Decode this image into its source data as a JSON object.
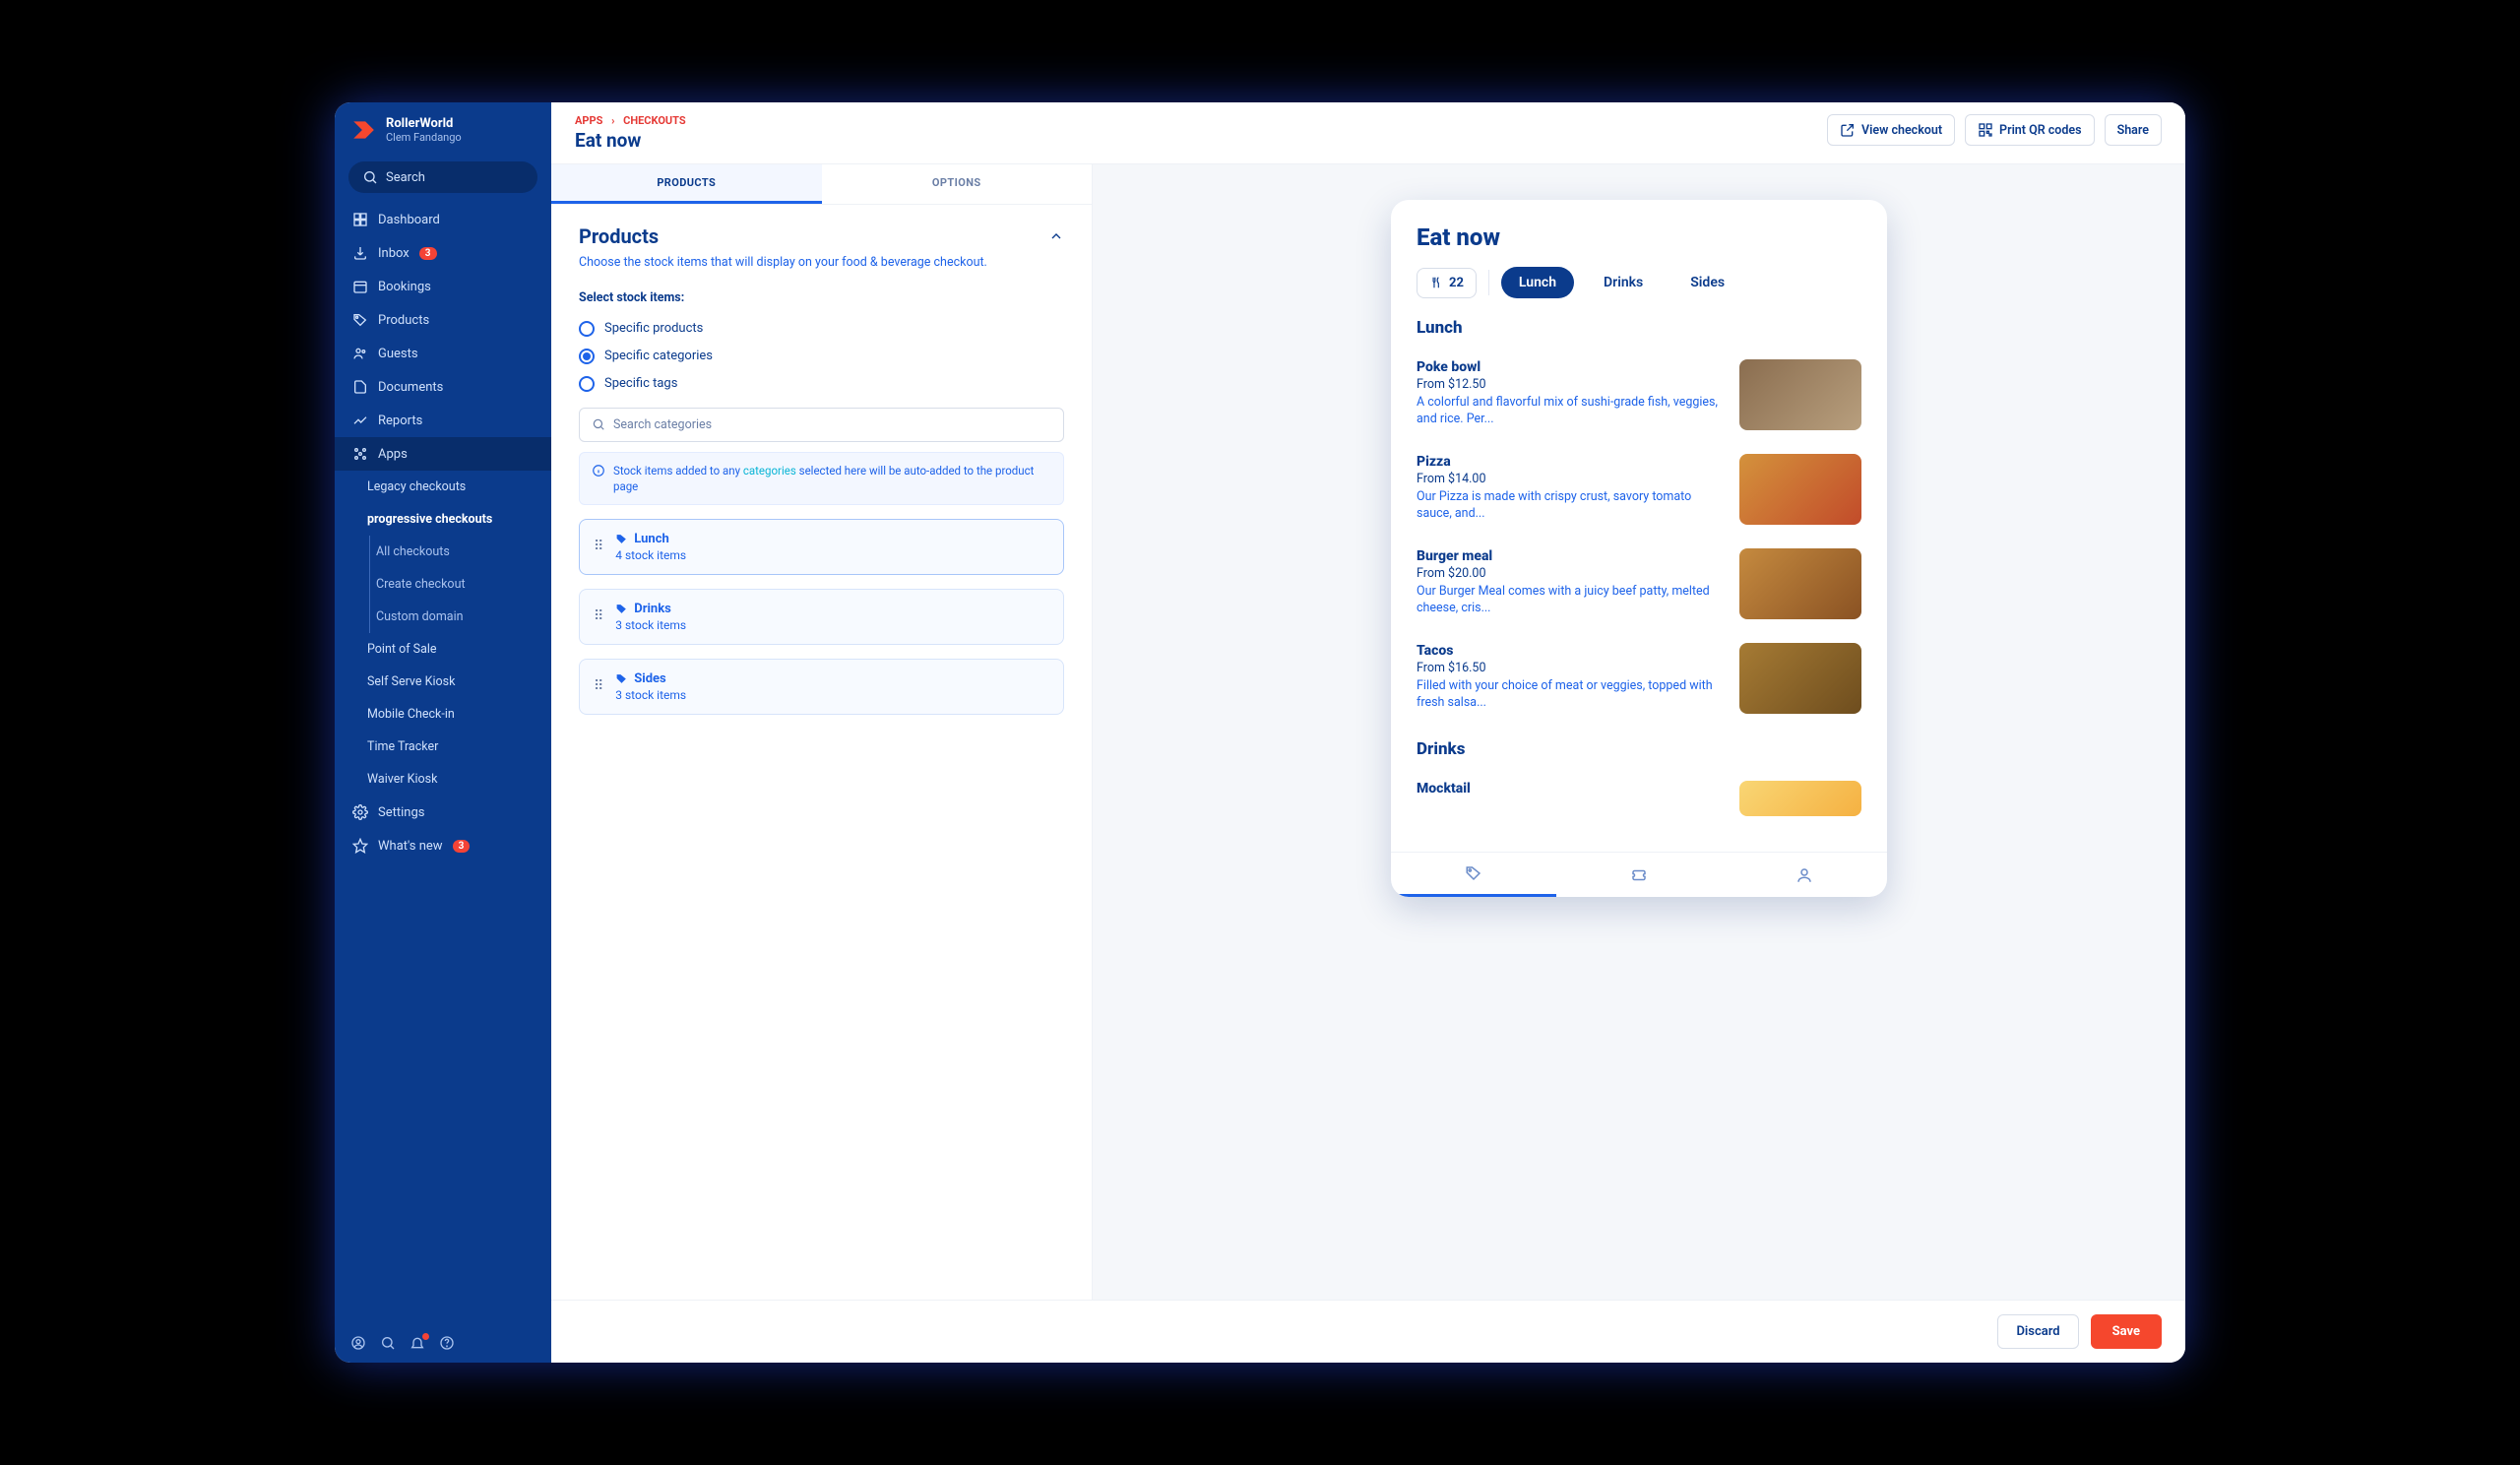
{
  "brand": {
    "title": "RollerWorld",
    "sub": "Clem Fandango"
  },
  "search": {
    "placeholder": "Search"
  },
  "nav": {
    "dashboard": "Dashboard",
    "inbox": "Inbox",
    "inbox_badge": "3",
    "bookings": "Bookings",
    "products": "Products",
    "guests": "Guests",
    "documents": "Documents",
    "reports": "Reports",
    "apps": "Apps",
    "legacy": "Legacy checkouts",
    "progressive": "progressive checkouts",
    "all": "All checkouts",
    "create": "Create checkout",
    "custom": "Custom domain",
    "pos": "Point of Sale",
    "kiosk": "Self Serve Kiosk",
    "mobile": "Mobile Check-in",
    "time": "Time Tracker",
    "waiver": "Waiver Kiosk",
    "settings": "Settings",
    "whatsnew": "What's new",
    "whatsnew_badge": "3"
  },
  "breadcrumb": {
    "a": "APPS",
    "b": "CHECKOUTS"
  },
  "page_title": "Eat now",
  "actions": {
    "view": "View checkout",
    "print": "Print QR codes",
    "share": "Share"
  },
  "tabs": {
    "products": "PRODUCTS",
    "options": "OPTIONS"
  },
  "section": {
    "title": "Products",
    "desc": "Choose the stock items that will display on your food & beverage checkout."
  },
  "select_label": "Select stock items:",
  "radios": {
    "products": "Specific products",
    "categories": "Specific categories",
    "tags": "Specific tags"
  },
  "cat_search": {
    "placeholder": "Search categories"
  },
  "info": {
    "pre": "Stock items added to any ",
    "hl": "categories",
    "post": " selected here will be auto-added to the product page"
  },
  "cats": [
    {
      "name": "Lunch",
      "count": "4 stock items"
    },
    {
      "name": "Drinks",
      "count": "3 stock items"
    },
    {
      "name": "Sides",
      "count": "3 stock items"
    }
  ],
  "preview": {
    "title": "Eat now",
    "count": "22",
    "chips": {
      "lunch": "Lunch",
      "drinks": "Drinks",
      "sides": "Sides"
    },
    "lunch_title": "Lunch",
    "drinks_title": "Drinks",
    "mocktail": "Mocktail",
    "items": [
      {
        "name": "Poke bowl",
        "price": "From $12.50",
        "desc": "A colorful and flavorful mix of sushi-grade fish, veggies, and rice. Per...",
        "bg": "linear-gradient(135deg,#8a6d4f,#b89f7e)"
      },
      {
        "name": "Pizza",
        "price": "From $14.00",
        "desc": "Our Pizza is made with crispy crust, savory tomato sauce, and...",
        "bg": "linear-gradient(135deg,#d4923c,#c24b2a)"
      },
      {
        "name": "Burger meal",
        "price": "From $20.00",
        "desc": "Our Burger Meal comes with a juicy beef patty, melted cheese, cris...",
        "bg": "linear-gradient(135deg,#c58a3f,#8a5223)"
      },
      {
        "name": "Tacos",
        "price": "From $16.50",
        "desc": "Filled with your choice of meat or veggies, topped with fresh salsa...",
        "bg": "linear-gradient(135deg,#a67b34,#6e4d1e)"
      }
    ]
  },
  "footer": {
    "discard": "Discard",
    "save": "Save"
  }
}
